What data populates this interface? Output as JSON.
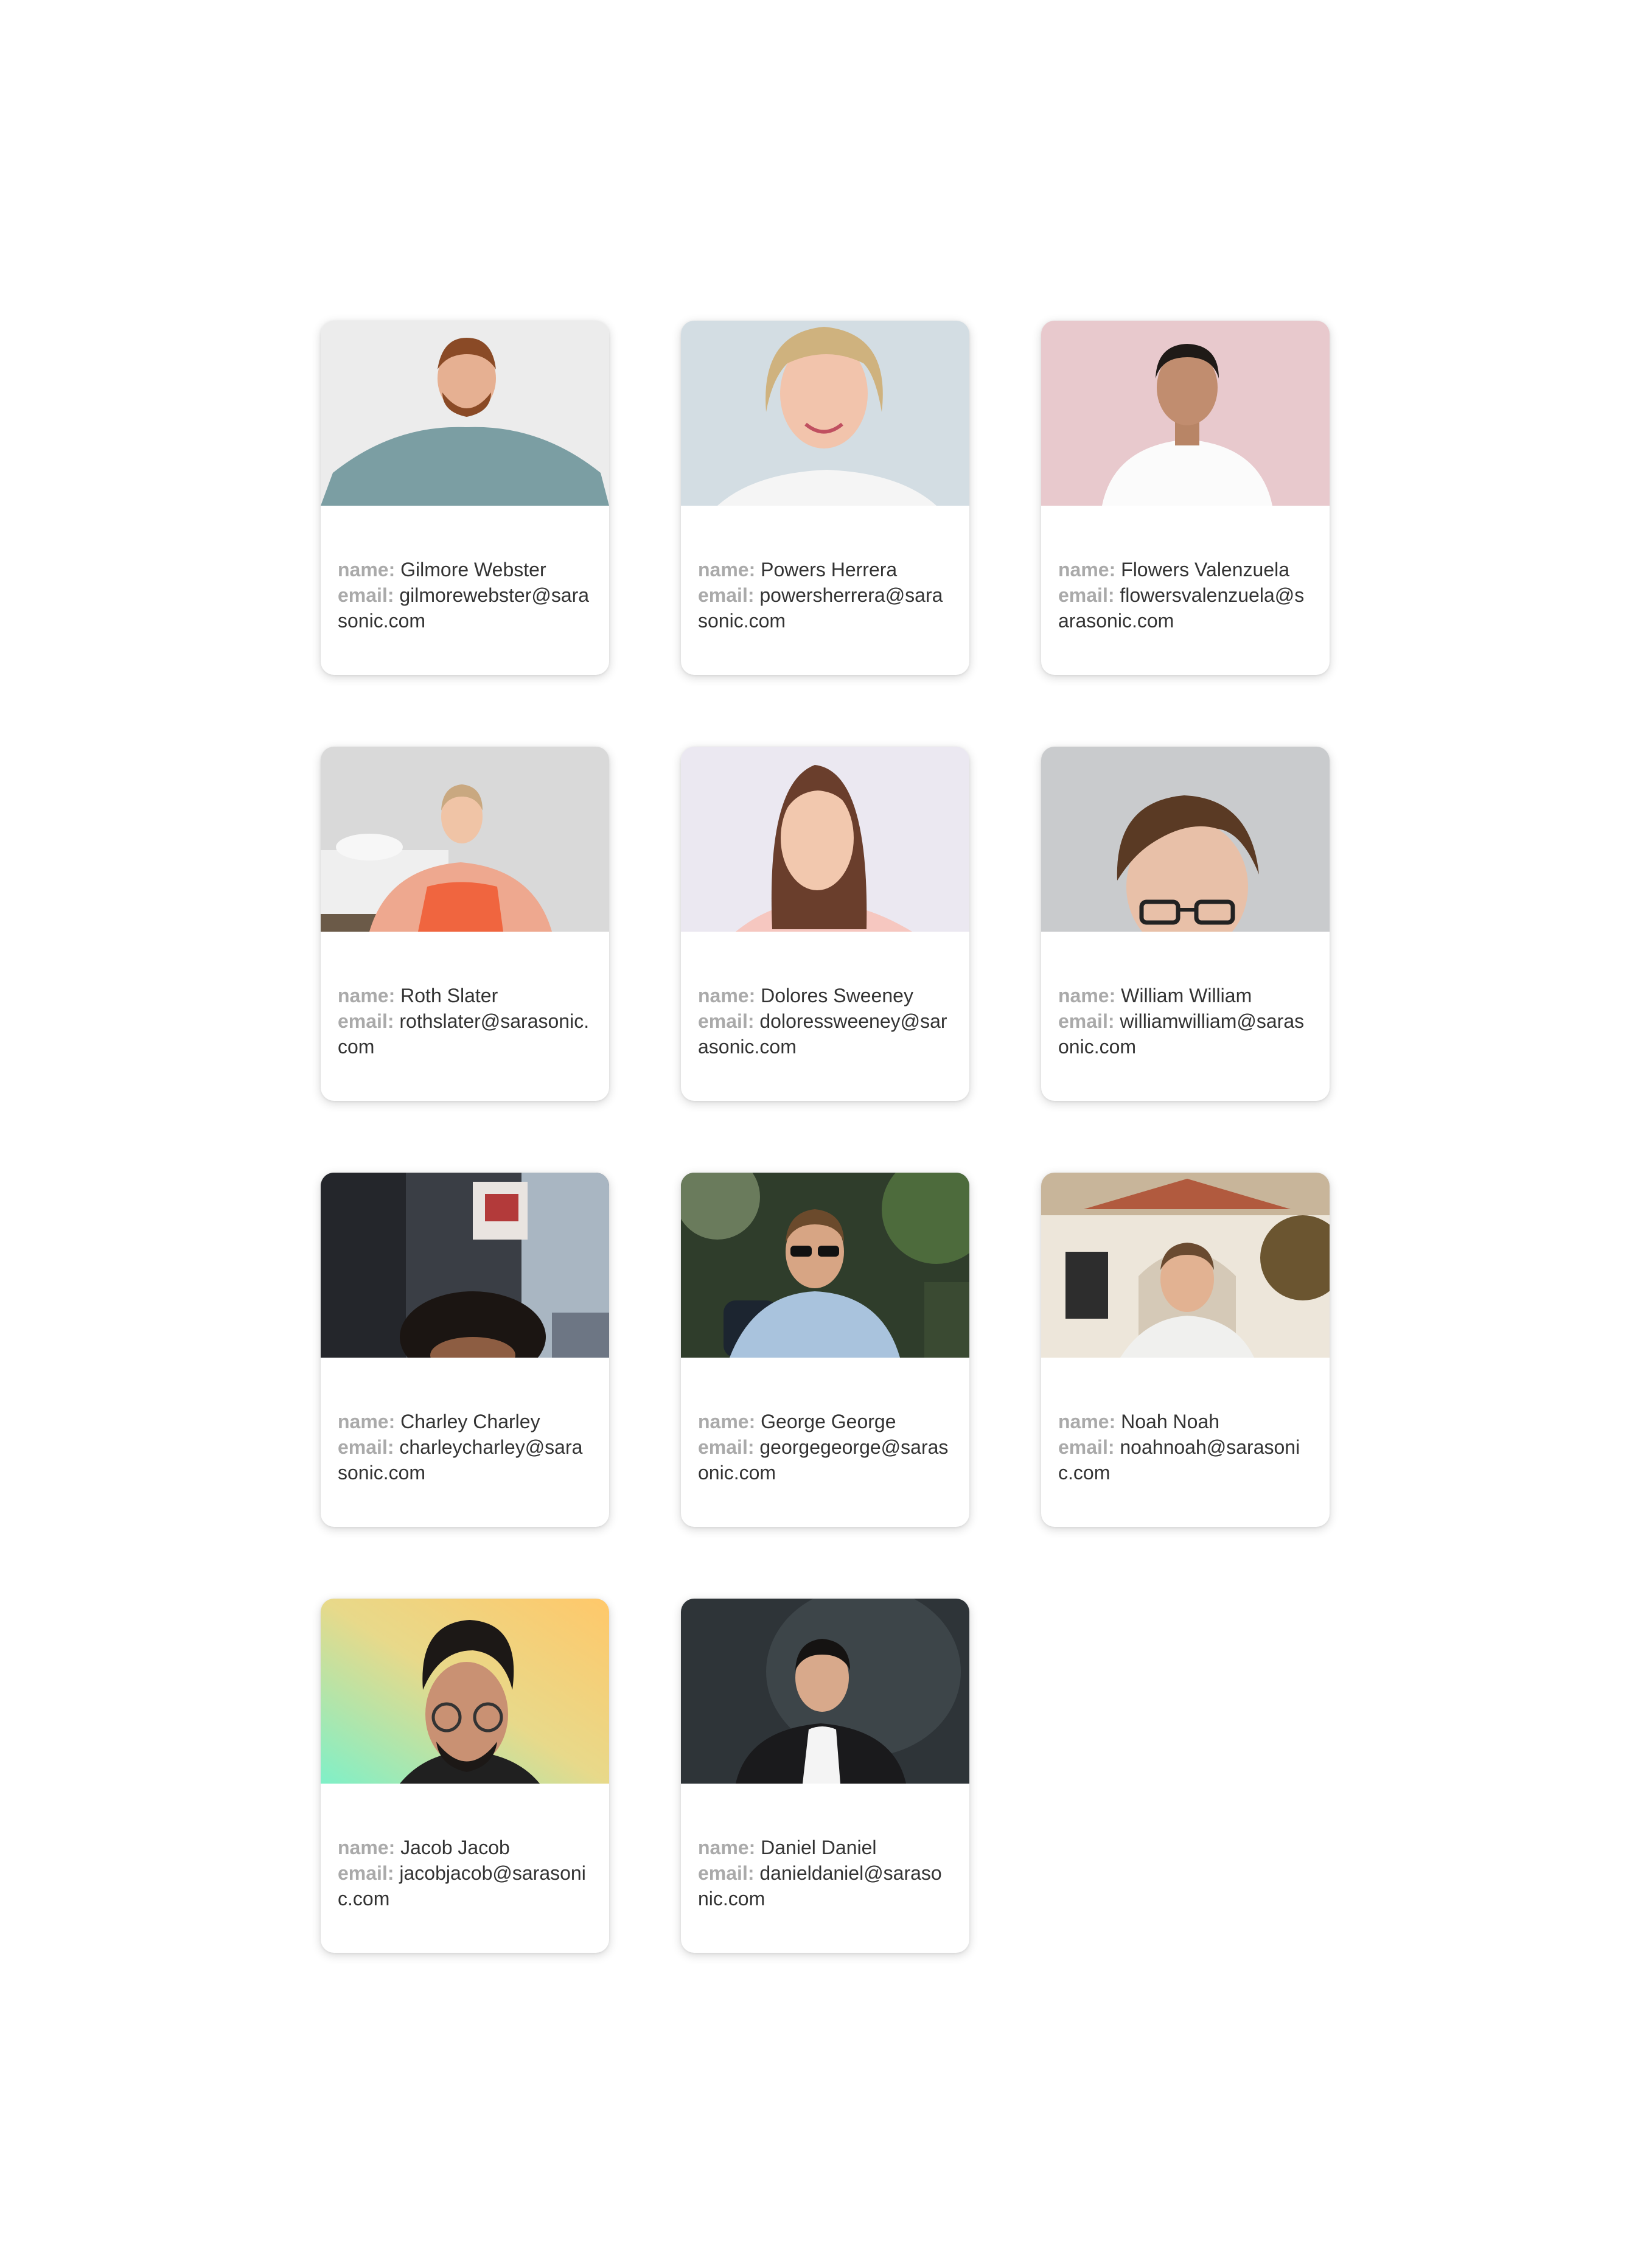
{
  "labels": {
    "name": "name:",
    "email": "email:"
  },
  "cards": [
    {
      "name": "Gilmore Webster",
      "email": "gilmorewebster@sarasonic.com",
      "photo_icon": "portrait-photo",
      "bg": "#ececec"
    },
    {
      "name": "Powers Herrera",
      "email": "powersherrera@sarasonic.com",
      "photo_icon": "portrait-photo",
      "bg": "#d3dde3"
    },
    {
      "name": "Flowers Valenzuela",
      "email": "flowersvalenzuela@sarasonic.com",
      "photo_icon": "portrait-photo",
      "bg": "#e8c9cd"
    },
    {
      "name": "Roth Slater",
      "email": "rothslater@sarasonic.com",
      "photo_icon": "portrait-photo",
      "bg": "#d9d9d9"
    },
    {
      "name": "Dolores Sweeney",
      "email": "doloressweeney@sarasonic.com",
      "photo_icon": "portrait-photo",
      "bg": "#ebe8f1"
    },
    {
      "name": "William William",
      "email": "williamwilliam@sarasonic.com",
      "photo_icon": "portrait-photo",
      "bg": "#c9cbcd"
    },
    {
      "name": "Charley Charley",
      "email": "charleycharley@sarasonic.com",
      "photo_icon": "portrait-photo",
      "bg": "#5d6068"
    },
    {
      "name": "George George",
      "email": "georgegeorge@sarasonic.com",
      "photo_icon": "portrait-photo",
      "bg": "#3c4a36"
    },
    {
      "name": "Noah Noah",
      "email": "noahnoah@sarasonic.com",
      "photo_icon": "portrait-photo",
      "bg": "#c8b59a"
    },
    {
      "name": "Jacob Jacob",
      "email": "jacobjacob@sarasonic.com",
      "photo_icon": "portrait-photo",
      "bg": "#bfe3a8"
    },
    {
      "name": "Daniel Daniel",
      "email": "danieldaniel@sarasonic.com",
      "photo_icon": "portrait-photo",
      "bg": "#2e3438"
    }
  ]
}
